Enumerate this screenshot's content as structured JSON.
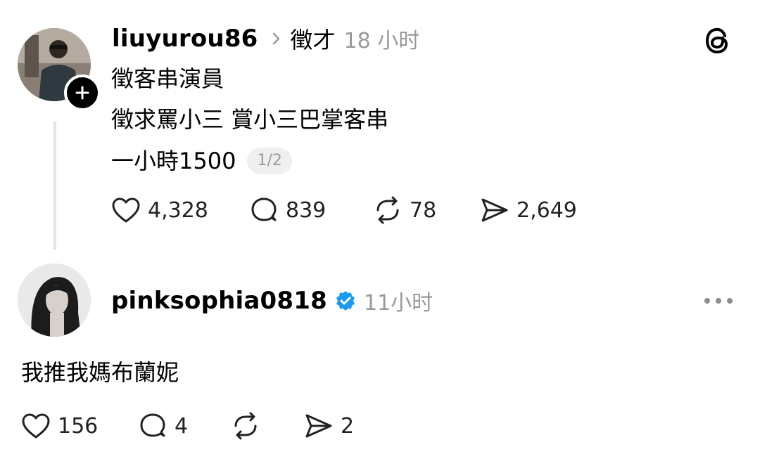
{
  "post": {
    "username": "liuyurou86",
    "topic": "徵才",
    "time": "18 小时",
    "lines": [
      "徵客串演員",
      "徵求罵小三 賞小三巴掌客串",
      "一小時1500"
    ],
    "carousel_indicator": "1/2",
    "actions": {
      "likes": "4,328",
      "comments": "839",
      "reposts": "78",
      "shares": "2,649"
    }
  },
  "reply": {
    "username": "pinksophia0818",
    "verified": true,
    "time": "11小时",
    "text": "我推我媽布蘭妮",
    "actions": {
      "likes": "156",
      "comments": "4",
      "shares": "2"
    }
  },
  "icons": {
    "threads_logo": "threads-logo-icon",
    "more": "more-icon",
    "verified": "verified-badge-icon",
    "verified_color": "#1d9bf0"
  }
}
